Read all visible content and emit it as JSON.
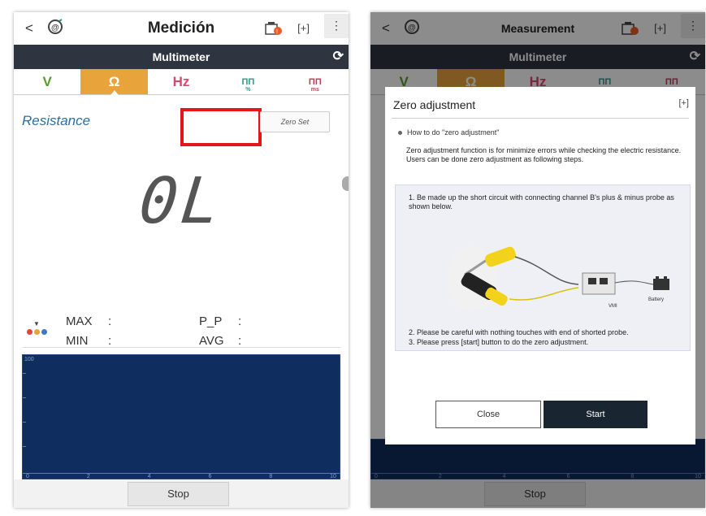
{
  "left": {
    "header": {
      "back": "<",
      "title": "Medición",
      "expand": "[+]",
      "menu": "⋮"
    },
    "subbar": {
      "title": "Multimeter"
    },
    "modes": [
      {
        "label": "V"
      },
      {
        "label": "Ω"
      },
      {
        "label": "Hz"
      },
      {
        "label": "ΠΠ",
        "sub": "%"
      },
      {
        "label": "ΠΠ",
        "sub": "ms"
      }
    ],
    "measurement": {
      "label": "Resistance",
      "zero_set": "Zero Set",
      "reading": "0L",
      "stats": {
        "max_label": "MAX",
        "max_value": ":",
        "min_label": "MIN",
        "min_value": ":",
        "pp_label": "P_P",
        "pp_value": ":",
        "avg_label": "AVG",
        "avg_value": ":"
      }
    },
    "graph": {
      "y_top": "100",
      "x_ticks": [
        "0",
        "2",
        "4",
        "6",
        "8",
        "10"
      ]
    },
    "bottom": {
      "stop": "Stop"
    }
  },
  "right": {
    "header": {
      "back": "<",
      "title": "Measurement",
      "expand": "[+]",
      "menu": "⋮"
    },
    "subbar": {
      "title": "Multimeter"
    },
    "modes": [
      {
        "label": "V"
      },
      {
        "label": "Ω"
      },
      {
        "label": "Hz"
      },
      {
        "label": "ΠΠ",
        "sub": "%"
      },
      {
        "label": "ΠΠ",
        "sub": "ms"
      }
    ],
    "dialog": {
      "title": "Zero adjustment",
      "expand": "[+]",
      "howto": "How to do \"zero adjustment\"",
      "desc_line1": "Zero adjustment function is for minimize errors while checking the electric resistance.",
      "desc_line2": "Users can be done zero adjustment as following steps.",
      "step1": "1. Be made up the short circuit with connecting channel B's plus & minus probe as shown below.",
      "step2": "2. Please be careful with nothing touches with end of shorted probe.",
      "step3": "3. Please press [start] button to do the zero adjustment.",
      "vmi_label": "VMI",
      "battery_label": "Battery",
      "close": "Close",
      "start": "Start"
    },
    "graph": {
      "x_ticks": [
        "0",
        "2",
        "4",
        "6",
        "8",
        "10"
      ]
    },
    "bottom": {
      "stop": "Stop"
    }
  },
  "colors": {
    "accent_orange": "#e8a33a",
    "dark_bar": "#2e3440",
    "graph_bg": "#0f2d5e",
    "highlight_red": "#e3161a",
    "start_btn": "#1a2532"
  }
}
